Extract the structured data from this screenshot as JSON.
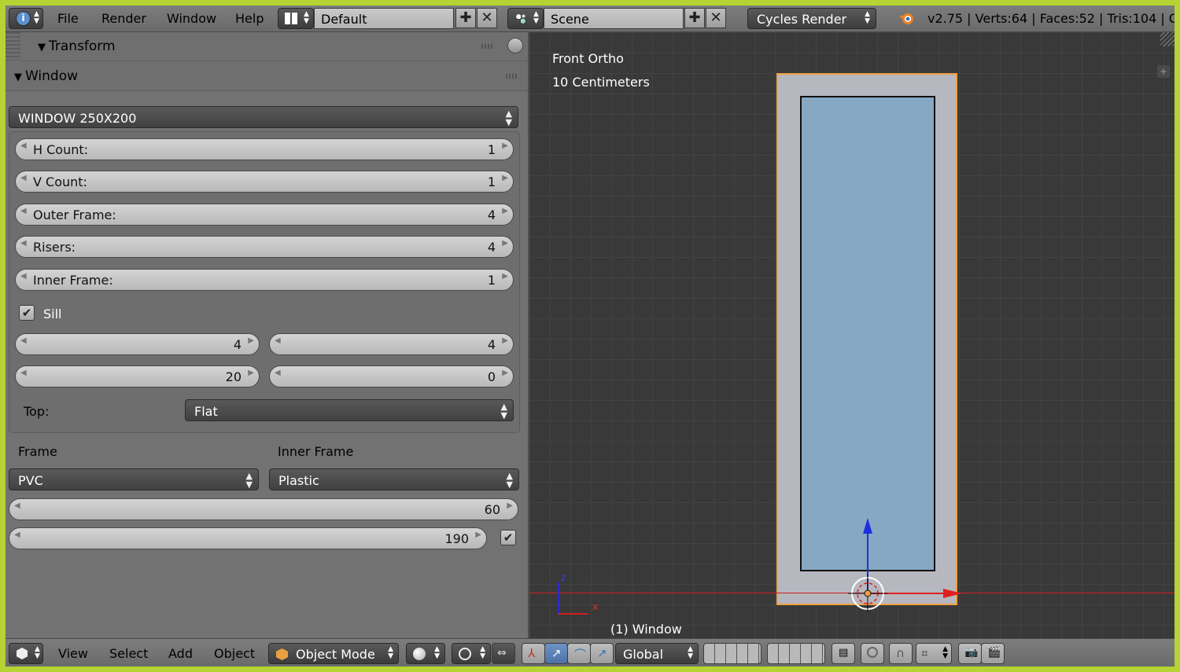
{
  "header": {
    "menus": [
      "File",
      "Render",
      "Window",
      "Help"
    ],
    "screen_layout": "Default",
    "scene": "Scene",
    "render_engine": "Cycles Render",
    "stats": "v2.75 | Verts:64 | Faces:52 | Tris:104 | Obj"
  },
  "panel": {
    "transform_title": "Transform",
    "window_title": "Window",
    "preset": "WINDOW 250X200",
    "fields": [
      {
        "label": "H Count:",
        "value": "1"
      },
      {
        "label": "V Count:",
        "value": "1"
      },
      {
        "label": "Outer Frame:",
        "value": "4"
      },
      {
        "label": "Risers:",
        "value": "4"
      },
      {
        "label": "Inner Frame:",
        "value": "1"
      }
    ],
    "sill_label": "Sill",
    "sill_checked": true,
    "sill_values": [
      "4",
      "4",
      "20",
      "0"
    ],
    "top_label": "Top:",
    "top_value": "Flat",
    "frame_label": "Frame",
    "inner_frame_label": "Inner Frame",
    "frame_material": "PVC",
    "inner_frame_material": "Plastic",
    "width_value": "60",
    "height_value": "190",
    "height_checked": true
  },
  "viewport": {
    "view_name": "Front Ortho",
    "scale": "10 Centimeters",
    "object_label": "(1) Window",
    "axis_z": "z",
    "axis_x": "x"
  },
  "footer": {
    "menus": [
      "View",
      "Select",
      "Add",
      "Object"
    ],
    "mode": "Object Mode",
    "orientation": "Global"
  },
  "colors": {
    "accent_border": "#b5d332",
    "glass": "#87a8c2",
    "frame": "#b7b7c0",
    "selection": "#f0a040"
  }
}
